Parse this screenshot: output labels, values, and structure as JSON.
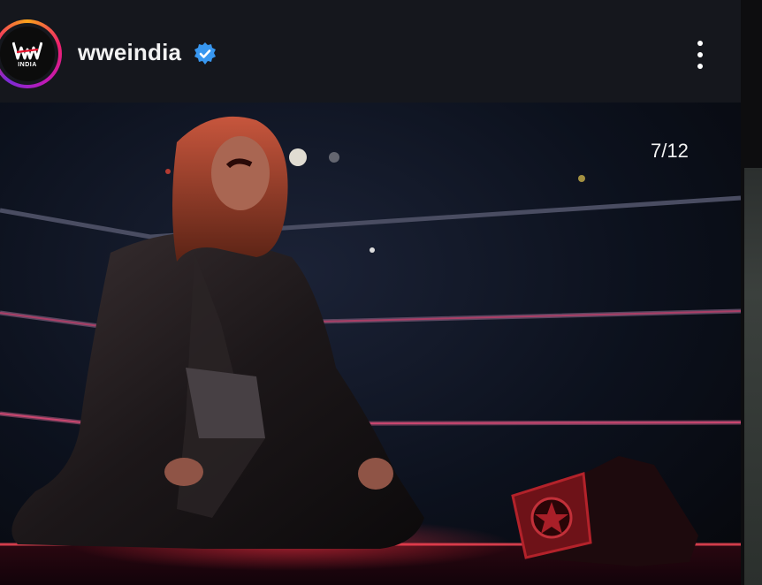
{
  "header": {
    "username": "wweindia",
    "avatar_subtext": "INDIA",
    "verified_icon": "verified-badge-icon",
    "more_icon": "more-vertical-icon"
  },
  "media": {
    "counter": "7/12",
    "description_icon": "wrestler-kneeling-photo"
  },
  "colors": {
    "header_bg": "#15171d",
    "verified_blue": "#3897f0",
    "ring_rope_pink": "#e03a6d"
  }
}
